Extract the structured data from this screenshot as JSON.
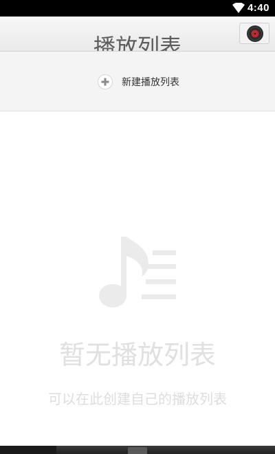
{
  "status_bar": {
    "time": "4:40",
    "wifi_icon": "wifi-icon"
  },
  "header": {
    "title": "播放列表",
    "disc_icon": "vinyl-disc-icon"
  },
  "new_playlist": {
    "label": "新建播放列表",
    "icon": "plus-icon"
  },
  "empty_state": {
    "icon": "music-note-list-icon",
    "title": "暂无播放列表",
    "subtitle": "可以在此创建自己的播放列表"
  },
  "colors": {
    "status_bar_bg": "#000000",
    "header_bg": "#f0f0f0",
    "panel_bg": "#f4f4f4",
    "empty_text": "#e0e0e0",
    "disc_red": "#c0282d"
  }
}
